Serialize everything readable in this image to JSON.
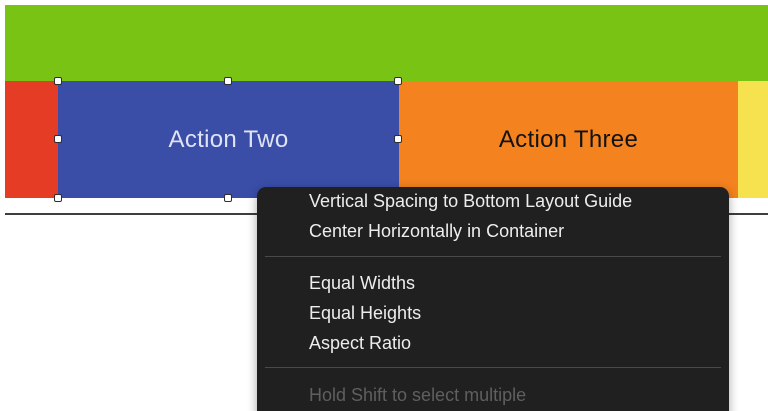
{
  "stack_view": {
    "segments": [
      {
        "id": "red",
        "label": "",
        "color": "#e43c25"
      },
      {
        "id": "blue",
        "label": "Action Two",
        "color": "#3a4ea8",
        "selected": true
      },
      {
        "id": "orange",
        "label": "Action Three",
        "color": "#f3821f"
      },
      {
        "id": "yellow",
        "label": "",
        "color": "#f5e24e"
      }
    ],
    "top_bar_color": "#79c314"
  },
  "context_menu": {
    "items": [
      {
        "label": "Vertical Spacing to Bottom Layout Guide",
        "enabled": true
      },
      {
        "label": "Center Horizontally in Container",
        "enabled": true
      },
      {
        "label": "Equal Widths",
        "enabled": true
      },
      {
        "label": "Equal Heights",
        "enabled": true
      },
      {
        "label": "Aspect Ratio",
        "enabled": true
      },
      {
        "label": "Hold Shift to select multiple",
        "enabled": false
      }
    ]
  }
}
